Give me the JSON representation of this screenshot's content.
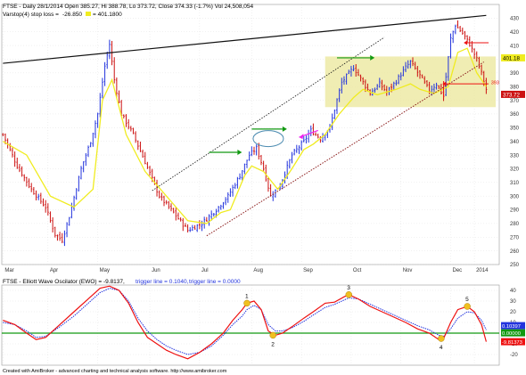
{
  "window": {
    "title_line": "FTSE - Daily 28/1/2014 Open 385.27, Hi 388.78, Lo 373.72, Close 374.33 (-1.7%) Vol 24,508,054",
    "stop_line_label": "Varstop(4) stop loss =",
    "stop_line_value": "-26.850",
    "stop_line_value2": "= 401.1800",
    "osc_title_prefix": "FTSE - Elliott Wave Oscilator (EWO) = -9.8137,",
    "osc_title_trigger": "trigger line = 0.1040,",
    "osc_title_trigger0": "trigger line = 0.0000",
    "footer": "Created with AmiBroker - advanced charting and technical analysis software. http://www.amibroker.com"
  },
  "colors": {
    "background": "#ffffff",
    "grid": "#d0d0d0",
    "up_bar": "#2233dd",
    "down_bar": "#cc1111",
    "stop_line": "#f0ec20",
    "channel_upper": "#111111",
    "channel_lower": "#8a1a1a",
    "highlight_box": "#ece8a0",
    "ewo_line": "#ee1111",
    "trigger_line": "#2233dd",
    "zero_line": "#119911",
    "wave_marker": "#f0c020",
    "arrow_green": "#119911",
    "arrow_magenta": "#ee22ee",
    "arrow_red": "#ee1111"
  },
  "chart_data": [
    {
      "type": "ohlc-bar",
      "title": "FTSE - Daily",
      "ylim": [
        250,
        440
      ],
      "y_ticks": [
        "250",
        "260",
        "270",
        "280",
        "290",
        "300",
        "310",
        "320",
        "330",
        "340",
        "350",
        "360",
        "370",
        "380",
        "390",
        "400",
        "410",
        "420",
        "430"
      ],
      "x_ticks": [
        "Mar",
        "Apr",
        "May",
        "Jun",
        "Jul",
        "Aug",
        "Sep",
        "Oct",
        "Nov",
        "Dec",
        "2014"
      ],
      "price_path": [
        [
          0,
          345
        ],
        [
          6,
          322
        ],
        [
          12,
          305
        ],
        [
          18,
          292
        ],
        [
          22,
          272
        ],
        [
          25,
          268
        ],
        [
          28,
          285
        ],
        [
          33,
          320
        ],
        [
          37,
          340
        ],
        [
          40,
          360
        ],
        [
          43,
          395
        ],
        [
          45,
          411
        ],
        [
          47,
          385
        ],
        [
          50,
          360
        ],
        [
          55,
          345
        ],
        [
          60,
          325
        ],
        [
          66,
          300
        ],
        [
          72,
          288
        ],
        [
          78,
          275
        ],
        [
          84,
          280
        ],
        [
          90,
          290
        ],
        [
          95,
          300
        ],
        [
          100,
          315
        ],
        [
          104,
          330
        ],
        [
          107,
          335
        ],
        [
          110,
          320
        ],
        [
          113,
          300
        ],
        [
          117,
          308
        ],
        [
          122,
          330
        ],
        [
          127,
          340
        ],
        [
          130,
          348
        ],
        [
          134,
          342
        ],
        [
          138,
          350
        ],
        [
          141,
          370
        ],
        [
          143,
          383
        ],
        [
          148,
          394
        ],
        [
          151,
          386
        ],
        [
          155,
          375
        ],
        [
          159,
          382
        ],
        [
          162,
          376
        ],
        [
          166,
          384
        ],
        [
          170,
          394
        ],
        [
          172,
          398
        ],
        [
          176,
          388
        ],
        [
          180,
          377
        ],
        [
          183,
          382
        ],
        [
          186,
          373
        ],
        [
          189,
          415
        ],
        [
          191,
          425
        ],
        [
          194,
          419
        ],
        [
          197,
          411
        ],
        [
          200,
          400
        ],
        [
          202,
          390
        ],
        [
          204,
          378
        ]
      ],
      "stop_line": [
        [
          0,
          340
        ],
        [
          10,
          330
        ],
        [
          20,
          300
        ],
        [
          30,
          292
        ],
        [
          38,
          305
        ],
        [
          42,
          370
        ],
        [
          46,
          385
        ],
        [
          52,
          345
        ],
        [
          60,
          318
        ],
        [
          70,
          298
        ],
        [
          78,
          282
        ],
        [
          86,
          280
        ],
        [
          92,
          288
        ],
        [
          96,
          290
        ],
        [
          102,
          315
        ],
        [
          105,
          322
        ],
        [
          110,
          318
        ],
        [
          116,
          305
        ],
        [
          122,
          320
        ],
        [
          127,
          334
        ],
        [
          131,
          338
        ],
        [
          136,
          345
        ],
        [
          142,
          360
        ],
        [
          148,
          372
        ],
        [
          152,
          378
        ],
        [
          158,
          374
        ],
        [
          166,
          378
        ],
        [
          172,
          382
        ],
        [
          176,
          378
        ],
        [
          182,
          375
        ],
        [
          188,
          380
        ],
        [
          192,
          405
        ],
        [
          196,
          408
        ],
        [
          200,
          390
        ],
        [
          204,
          380
        ]
      ],
      "upper_channel": [
        [
          0,
          397
        ],
        [
          204,
          432
        ]
      ],
      "upper_channel_2": [
        [
          63,
          304
        ],
        [
          161,
          416
        ]
      ],
      "lower_channel": [
        [
          86,
          271
        ],
        [
          203,
          398
        ]
      ],
      "highlight_box": {
        "x": [
          136,
          208
        ],
        "y": [
          365,
          402
        ]
      },
      "labels": {
        "current_price": "373.72",
        "stop_value": "401.18",
        "target_marker": "393"
      }
    },
    {
      "type": "line",
      "title": "FTSE - Elliott Wave Oscilator (EWO)",
      "ylim": [
        -30,
        45
      ],
      "y_ticks": [
        "-20",
        "-10",
        "0",
        "10",
        "20",
        "30",
        "40"
      ],
      "series": [
        {
          "name": "EWO",
          "values": [
            [
              0,
              12
            ],
            [
              5,
              8
            ],
            [
              10,
              0
            ],
            [
              14,
              -6
            ],
            [
              18,
              -4
            ],
            [
              24,
              8
            ],
            [
              30,
              20
            ],
            [
              36,
              32
            ],
            [
              41,
              42
            ],
            [
              45,
              44
            ],
            [
              49,
              40
            ],
            [
              53,
              28
            ],
            [
              57,
              10
            ],
            [
              61,
              -4
            ],
            [
              65,
              -10
            ],
            [
              69,
              -16
            ],
            [
              73,
              -20
            ],
            [
              78,
              -24
            ],
            [
              83,
              -18
            ],
            [
              88,
              -10
            ],
            [
              93,
              0
            ],
            [
              97,
              12
            ],
            [
              101,
              22
            ],
            [
              103,
              28
            ],
            [
              106,
              30
            ],
            [
              109,
              22
            ],
            [
              112,
              2
            ],
            [
              115,
              -2
            ],
            [
              118,
              0
            ],
            [
              122,
              6
            ],
            [
              127,
              14
            ],
            [
              131,
              20
            ],
            [
              136,
              28
            ],
            [
              140,
              29
            ],
            [
              144,
              34
            ],
            [
              146,
              36
            ],
            [
              150,
              32
            ],
            [
              155,
              25
            ],
            [
              160,
              20
            ],
            [
              165,
              15
            ],
            [
              170,
              10
            ],
            [
              175,
              4
            ],
            [
              180,
              0
            ],
            [
              184,
              -6
            ],
            [
              186,
              -5
            ],
            [
              189,
              10
            ],
            [
              192,
              22
            ],
            [
              196,
              25
            ],
            [
              199,
              20
            ],
            [
              202,
              8
            ],
            [
              204,
              -8
            ]
          ]
        },
        {
          "name": "trigger line",
          "values": [
            [
              0,
              10
            ],
            [
              5,
              8
            ],
            [
              10,
              2
            ],
            [
              14,
              -4
            ],
            [
              18,
              -3
            ],
            [
              24,
              6
            ],
            [
              30,
              16
            ],
            [
              36,
              28
            ],
            [
              41,
              38
            ],
            [
              45,
              42
            ],
            [
              49,
              40
            ],
            [
              53,
              30
            ],
            [
              57,
              14
            ],
            [
              61,
              2
            ],
            [
              65,
              -6
            ],
            [
              69,
              -12
            ],
            [
              73,
              -16
            ],
            [
              78,
              -20
            ],
            [
              83,
              -18
            ],
            [
              88,
              -12
            ],
            [
              93,
              -2
            ],
            [
              97,
              8
            ],
            [
              101,
              16
            ],
            [
              103,
              22
            ],
            [
              106,
              26
            ],
            [
              109,
              22
            ],
            [
              112,
              8
            ],
            [
              115,
              2
            ],
            [
              118,
              2
            ],
            [
              122,
              5
            ],
            [
              127,
              11
            ],
            [
              131,
              17
            ],
            [
              136,
              24
            ],
            [
              140,
              27
            ],
            [
              144,
              31
            ],
            [
              146,
              33
            ],
            [
              150,
              32
            ],
            [
              155,
              27
            ],
            [
              160,
              22
            ],
            [
              165,
              17
            ],
            [
              170,
              12
            ],
            [
              175,
              7
            ],
            [
              180,
              3
            ],
            [
              184,
              -2
            ],
            [
              186,
              -3
            ],
            [
              189,
              4
            ],
            [
              192,
              14
            ],
            [
              196,
              20
            ],
            [
              199,
              19
            ],
            [
              202,
              12
            ],
            [
              204,
              3
            ]
          ]
        }
      ],
      "wave_labels": [
        {
          "label": "1",
          "x": 103,
          "y": 28
        },
        {
          "label": "2",
          "x": 114,
          "y": -2
        },
        {
          "label": "3",
          "x": 146,
          "y": 36
        },
        {
          "label": "4",
          "x": 185,
          "y": -5
        },
        {
          "label": "5",
          "x": 196,
          "y": 25
        }
      ],
      "value_labels": {
        "trigger": "0.10397",
        "zero": "0.00000",
        "ewo": "-9.81373"
      }
    }
  ]
}
